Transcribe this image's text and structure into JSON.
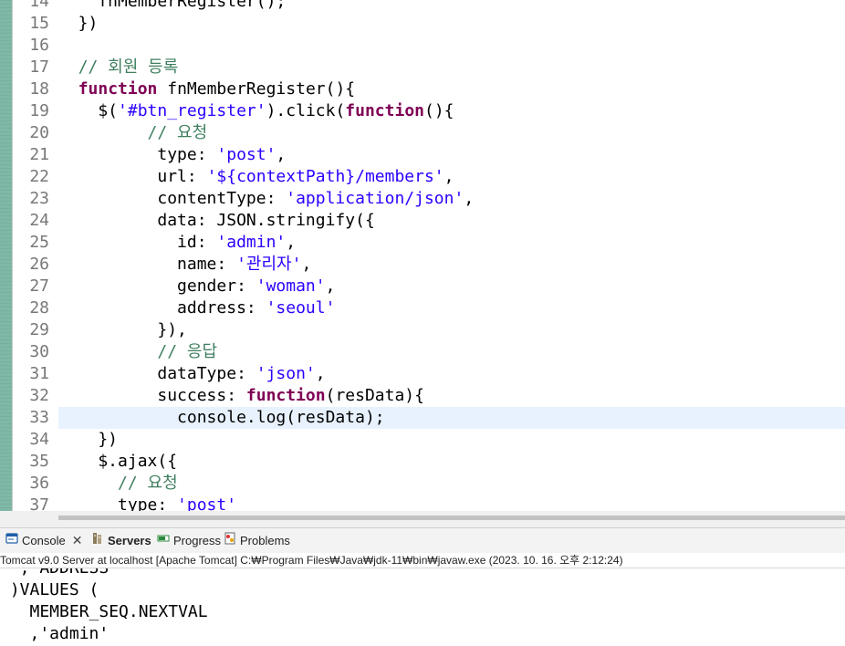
{
  "editor": {
    "lines": [
      {
        "n": "14",
        "parts": [
          [
            "plain",
            "    fnMemberRegister();"
          ]
        ]
      },
      {
        "n": "15",
        "parts": [
          [
            "plain",
            "  })"
          ]
        ]
      },
      {
        "n": "16",
        "parts": [
          [
            "plain",
            ""
          ]
        ]
      },
      {
        "n": "17",
        "parts": [
          [
            "plain",
            "  "
          ],
          [
            "cmt",
            "// 회원 등록"
          ]
        ]
      },
      {
        "n": "18",
        "parts": [
          [
            "plain",
            "  "
          ],
          [
            "kw",
            "function"
          ],
          [
            "plain",
            " fnMemberRegister(){"
          ]
        ]
      },
      {
        "n": "19",
        "parts": [
          [
            "plain",
            "    $("
          ],
          [
            "str",
            "'#btn_register'"
          ],
          [
            "plain",
            ").click("
          ],
          [
            "kw",
            "function"
          ],
          [
            "plain",
            "(){"
          ]
        ]
      },
      {
        "n": "20",
        "parts": [
          [
            "plain",
            "         "
          ],
          [
            "cmt",
            "// 요청"
          ]
        ]
      },
      {
        "n": "21",
        "parts": [
          [
            "plain",
            "          type: "
          ],
          [
            "str",
            "'post'"
          ],
          [
            "plain",
            ","
          ]
        ]
      },
      {
        "n": "22",
        "parts": [
          [
            "plain",
            "          url: "
          ],
          [
            "str",
            "'${contextPath}/members'"
          ],
          [
            "plain",
            ","
          ]
        ]
      },
      {
        "n": "23",
        "parts": [
          [
            "plain",
            "          contentType: "
          ],
          [
            "str",
            "'application/json'"
          ],
          [
            "plain",
            ","
          ]
        ]
      },
      {
        "n": "24",
        "parts": [
          [
            "plain",
            "          data: JSON.stringify({"
          ]
        ]
      },
      {
        "n": "25",
        "parts": [
          [
            "plain",
            "            id: "
          ],
          [
            "str",
            "'admin'"
          ],
          [
            "plain",
            ","
          ]
        ]
      },
      {
        "n": "26",
        "parts": [
          [
            "plain",
            "            name: "
          ],
          [
            "str",
            "'관리자'"
          ],
          [
            "plain",
            ","
          ]
        ]
      },
      {
        "n": "27",
        "parts": [
          [
            "plain",
            "            gender: "
          ],
          [
            "str",
            "'woman'"
          ],
          [
            "plain",
            ","
          ]
        ]
      },
      {
        "n": "28",
        "parts": [
          [
            "plain",
            "            address: "
          ],
          [
            "str",
            "'seoul'"
          ]
        ]
      },
      {
        "n": "29",
        "parts": [
          [
            "plain",
            "          }),"
          ]
        ]
      },
      {
        "n": "30",
        "parts": [
          [
            "plain",
            "          "
          ],
          [
            "cmt",
            "// 응답"
          ]
        ]
      },
      {
        "n": "31",
        "parts": [
          [
            "plain",
            "          dataType: "
          ],
          [
            "str",
            "'json'"
          ],
          [
            "plain",
            ","
          ]
        ]
      },
      {
        "n": "32",
        "parts": [
          [
            "plain",
            "          success: "
          ],
          [
            "kw",
            "function"
          ],
          [
            "plain",
            "(resData){"
          ]
        ]
      },
      {
        "n": "33",
        "parts": [
          [
            "plain",
            "            console.log(resData);"
          ]
        ],
        "current": true
      },
      {
        "n": "34",
        "parts": [
          [
            "plain",
            "    })"
          ]
        ]
      },
      {
        "n": "35",
        "parts": [
          [
            "plain",
            "    $.ajax({"
          ]
        ]
      },
      {
        "n": "36",
        "parts": [
          [
            "plain",
            "      "
          ],
          [
            "cmt",
            "// 요청"
          ]
        ]
      },
      {
        "n": "37",
        "parts": [
          [
            "plain",
            "      type: "
          ],
          [
            "str",
            "'post'"
          ]
        ]
      }
    ]
  },
  "tabs": [
    {
      "label": "Console",
      "icon": "console-icon",
      "active": false,
      "closable": true
    },
    {
      "label": "Servers",
      "icon": "servers-icon",
      "active": true,
      "closable": false
    },
    {
      "label": "Progress",
      "icon": "progress-icon",
      "active": false,
      "closable": false
    },
    {
      "label": "Problems",
      "icon": "problems-icon",
      "active": false,
      "closable": false
    }
  ],
  "status": {
    "text": "Tomcat v9.0 Server at localhost [Apache Tomcat] C:₩Program Files₩Java₩jdk-11₩bin₩javaw.exe  (2023. 10. 16. 오후 2:12:24)"
  },
  "console": {
    "lines": [
      "  , ADDRESS",
      " )VALUES (",
      "   MEMBER_SEQ.NEXTVAL",
      "   ,'admin'"
    ]
  },
  "colors": {
    "keyword": "#7f0055",
    "string": "#2a00ff",
    "comment": "#3f7f5f",
    "current_line": "#e8f2fe"
  }
}
